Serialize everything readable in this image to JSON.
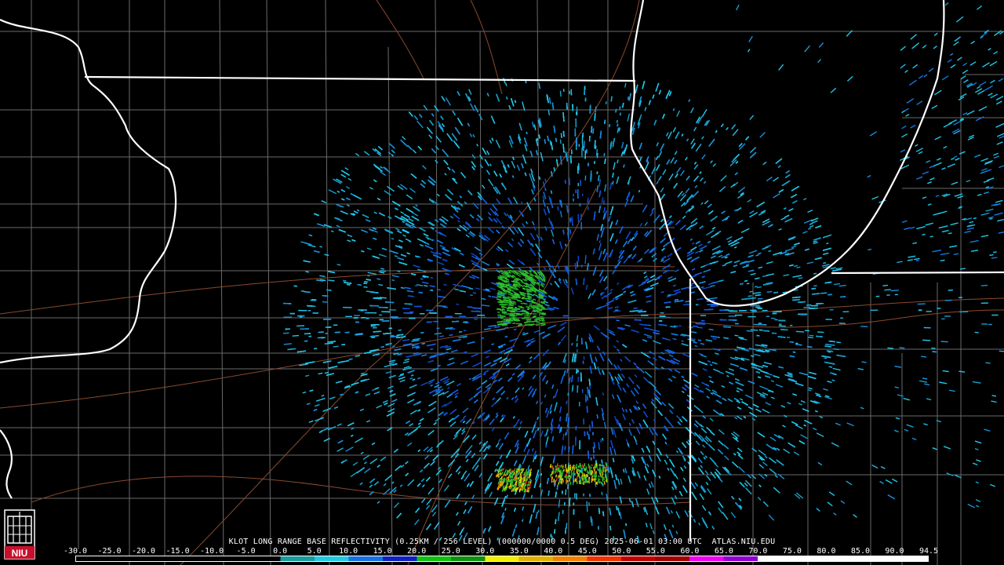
{
  "product_title": "KLOT LONG RANGE BASE REFLECTIVITY (0.25KM / 256 LEVEL) (000000/0000 0.5 DEG) 2025-06-01 03:00 UTC  ATLAS.NIU.EDU",
  "logo": {
    "text": "NIU",
    "color": "#c8102e"
  },
  "scale": {
    "labels": [
      "-30.0",
      "-25.0",
      "-20.0",
      "-15.0",
      "-10.0",
      "-5.0",
      "0.0",
      "5.0",
      "10.0",
      "15.0",
      "20.0",
      "25.0",
      "30.0",
      "35.0",
      "40.0",
      "45.0",
      "50.0",
      "55.0",
      "60.0",
      "65.0",
      "70.0",
      "75.0",
      "80.0",
      "85.0",
      "90.0",
      "94.5"
    ],
    "colors": [
      "#000000",
      "#000000",
      "#000000",
      "#000000",
      "#000000",
      "#000000",
      "#1a9a9a",
      "#20c8e0",
      "#1870e0",
      "#1020c0",
      "#10c010",
      "#109010",
      "#f0f000",
      "#e0b000",
      "#f08000",
      "#f03000",
      "#c00000",
      "#a00000",
      "#f000f0",
      "#9000d0",
      "#ffffff",
      "#ffffff",
      "#ffffff",
      "#ffffff",
      "#ffffff"
    ]
  },
  "map": {
    "background": "#000000",
    "state_border_color": "#ffffff",
    "county_line_color": "#707070",
    "road_color": "#8a4a30",
    "reflectivity_colors": [
      "#17a0c8",
      "#1fc8e8",
      "#1aa8d8",
      "#1478e0",
      "#1050d0",
      "#0c30b8",
      "#30c030",
      "#20a020",
      "#e0e000",
      "#f0a000",
      "#e03020"
    ]
  }
}
